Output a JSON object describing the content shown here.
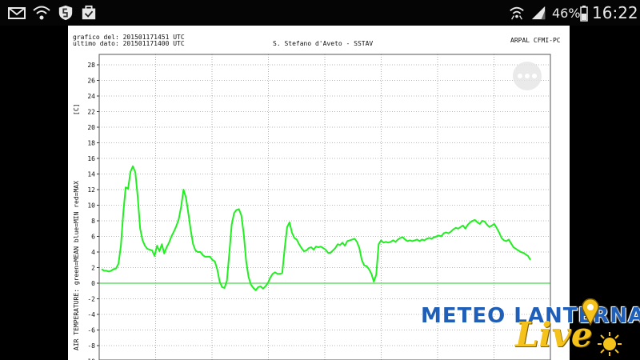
{
  "status_bar": {
    "battery": "46%",
    "time": "16:22",
    "icons": [
      "mail-icon",
      "wifi-icon",
      "shield-icon",
      "briefcase-check-icon",
      "wifi-signal-icon",
      "cell-signal-icon",
      "battery-icon"
    ]
  },
  "chart_header": {
    "generated_label": "grafico del: 201501171451 UTC",
    "last_data_label": "ultimo dato: 201501171400 UTC",
    "station": "S. Stefano d'Aveto - SSTAV",
    "source": "ARPAL CFMI-PC"
  },
  "colors": {
    "series": "#22ee22",
    "zero_line": "#22cc22",
    "grid": "#777777",
    "logo_blue": "#1f5fb8",
    "logo_yellow": "#f4c21a"
  },
  "logo": {
    "name": "METEO LANTERNA",
    "tagline": "Live"
  },
  "chart_data": {
    "type": "line",
    "title": "S. Stefano d'Aveto - SSTAV",
    "xlabel": "",
    "ylabel": "AIR TEMPERATURE: green=MEAN blue=MIN red=MAX",
    "yunit": "[C]",
    "ylim": [
      -10,
      29
    ],
    "yticks": [
      -10,
      -8,
      -6,
      -4,
      -2,
      0,
      2,
      4,
      6,
      8,
      10,
      12,
      14,
      16,
      18,
      20,
      22,
      24,
      26,
      28
    ],
    "grid": true,
    "legend": "none",
    "series": [
      {
        "color": "#22ee22",
        "values": [
          1.8,
          1.6,
          1.6,
          1.5,
          1.6,
          1.8,
          1.9,
          2.5,
          4.8,
          9.0,
          12.3,
          12.1,
          14.3,
          15.0,
          14.2,
          11.0,
          7.0,
          5.5,
          4.8,
          4.4,
          4.3,
          4.2,
          3.5,
          4.8,
          4.1,
          5.0,
          3.8,
          4.6,
          5.2,
          6.0,
          6.6,
          7.3,
          8.2,
          9.8,
          12.0,
          11.0,
          9.0,
          6.8,
          5.0,
          4.2,
          4.0,
          4.0,
          3.6,
          3.4,
          3.4,
          3.4,
          3.0,
          2.8,
          1.8,
          0.2,
          -0.5,
          -0.6,
          0.3,
          3.8,
          7.5,
          9.0,
          9.4,
          9.5,
          8.7,
          6.3,
          2.8,
          0.8,
          -0.2,
          -0.6,
          -0.9,
          -0.5,
          -0.4,
          -0.7,
          -0.4,
          0.0,
          0.7,
          1.2,
          1.4,
          1.2,
          1.2,
          1.3,
          4.5,
          7.2,
          7.8,
          6.5,
          5.8,
          5.6,
          5.0,
          4.5,
          4.1,
          4.2,
          4.5,
          4.6,
          4.3,
          4.7,
          4.6,
          4.7,
          4.5,
          4.3,
          3.9,
          3.9,
          4.2,
          4.5,
          5.0,
          4.9,
          5.2,
          4.8,
          5.4,
          5.5,
          5.6,
          5.7,
          5.3,
          4.5,
          3.0,
          2.3,
          2.2,
          1.8,
          1.2,
          0.2,
          1.1,
          5.0,
          5.5,
          5.2,
          5.3,
          5.2,
          5.3,
          5.5,
          5.3,
          5.6,
          5.8,
          5.9,
          5.6,
          5.4,
          5.5,
          5.4,
          5.5,
          5.6,
          5.4,
          5.6,
          5.5,
          5.7,
          5.8,
          5.7,
          5.9,
          6.0,
          6.1,
          6.0,
          6.4,
          6.5,
          6.4,
          6.6,
          6.9,
          7.1,
          7.0,
          7.2,
          7.4,
          7.0,
          7.5,
          7.8,
          8.0,
          8.1,
          7.8,
          7.6,
          8.0,
          7.9,
          7.5,
          7.2,
          7.4,
          7.6,
          7.1,
          6.5,
          5.8,
          5.5,
          5.4,
          5.6,
          5.1,
          4.6,
          4.4,
          4.2,
          4.0,
          3.9,
          3.7,
          3.5,
          3.0
        ]
      },
      {
        "color": "#22cc22",
        "values": [
          0,
          0
        ]
      }
    ]
  }
}
